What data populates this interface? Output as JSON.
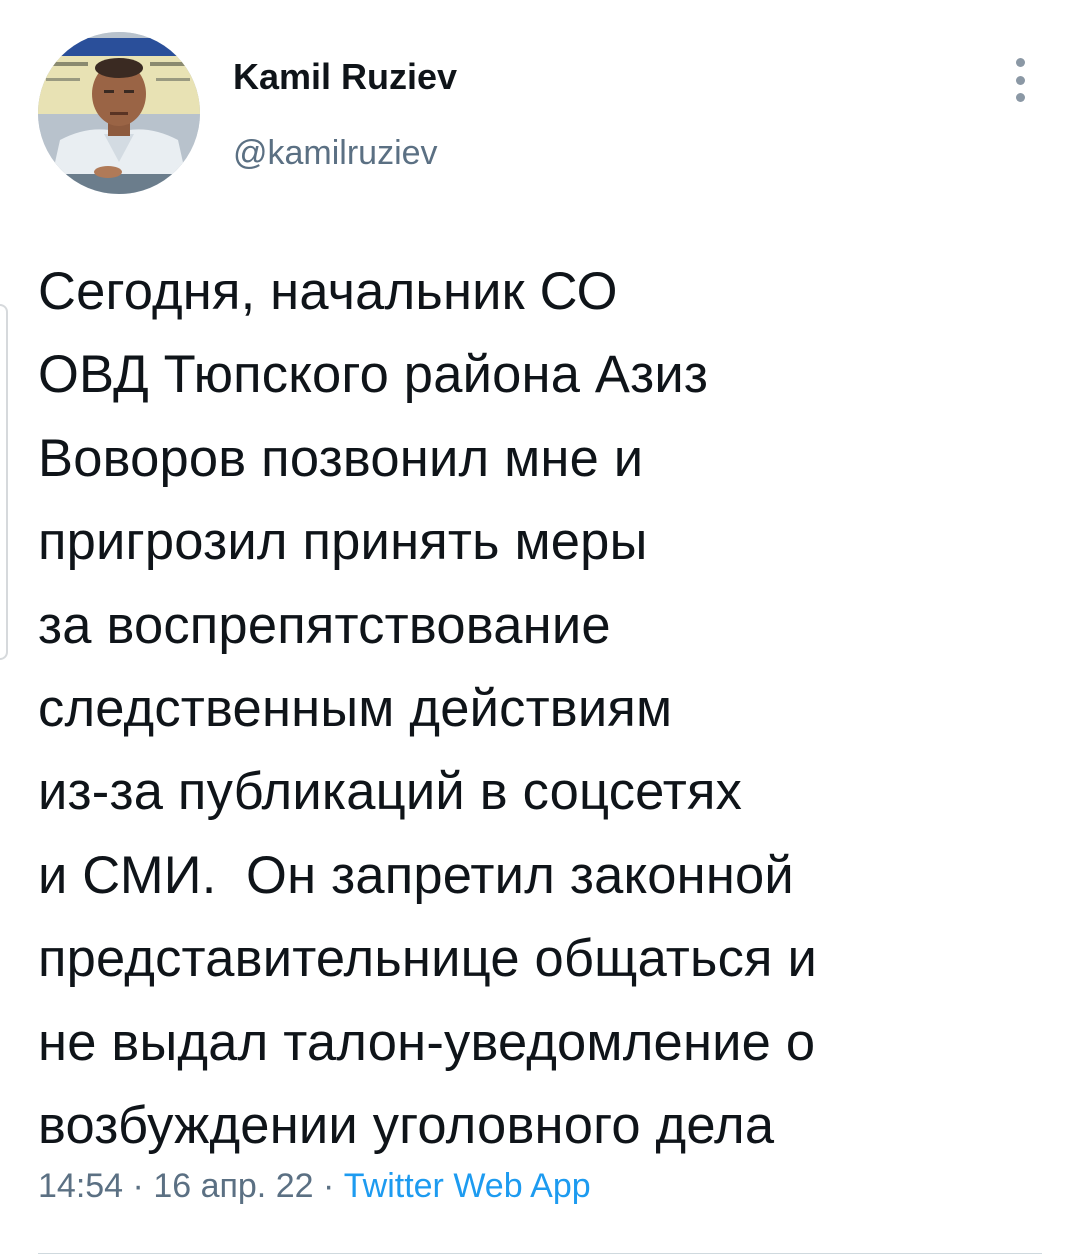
{
  "author": {
    "name": "Kamil Ruziev",
    "handle": "@kamilruziev",
    "avatar_icon": "profile-photo"
  },
  "more_icon": "vertical-ellipsis-icon",
  "tweet": {
    "lines": [
      "Сегодня, начальник СО",
      "ОВД Тюпского района Азиз",
      "Воворов позвонил мне и",
      "пригрозил принять меры",
      "за воспрепятствование",
      "следственным действиям",
      "из-за публикаций в соцсетях",
      "и СМИ.  Он запретил законной",
      "представительнице общаться и",
      "не выдал талон-уведомление о",
      "возбуждении уголовного дела"
    ]
  },
  "meta": {
    "time": "14:54",
    "separator": " · ",
    "date": "16 апр. 22",
    "source": "Twitter Web App"
  },
  "colors": {
    "text": "#0f1419",
    "secondary": "#5b7083",
    "link": "#1d9bf0"
  }
}
